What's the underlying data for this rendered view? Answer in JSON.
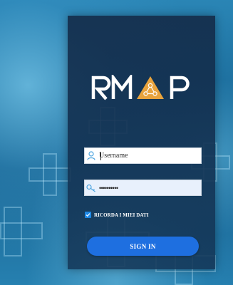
{
  "brand": {
    "logo_text": "RMAP",
    "accent_color": "#e8a33d"
  },
  "login": {
    "username_placeholder": "Username",
    "password_value": "••••••••••",
    "remember_label": "RICORDA I MIEI DATI",
    "remember_checked": true,
    "signin_label": "SIGN IN"
  },
  "icons": {
    "username": "user-icon",
    "password": "key-icon",
    "checkbox": "check-icon"
  },
  "colors": {
    "primary_button": "#1e6fe0",
    "checkbox": "#1e88e5",
    "panel": "#142d4b"
  }
}
